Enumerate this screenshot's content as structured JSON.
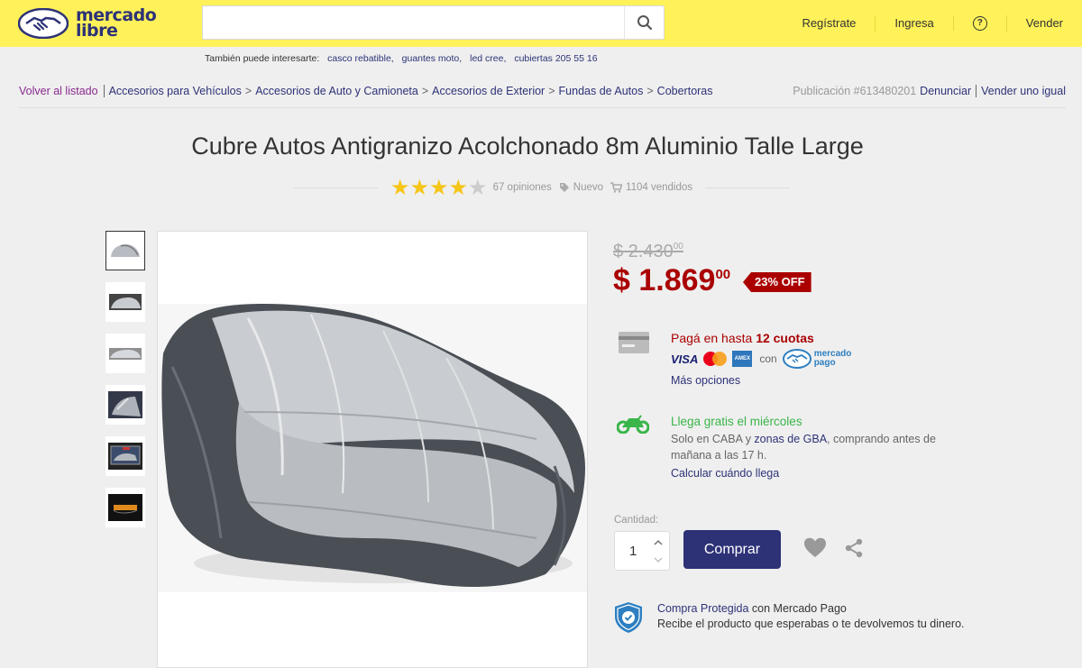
{
  "header": {
    "logo_line1": "mercado",
    "logo_line2": "libre",
    "search": {
      "value": "",
      "placeholder": ""
    },
    "nav": {
      "register": "Regístrate",
      "login": "Ingresa",
      "help": "?",
      "sell": "Vender"
    },
    "colors": {
      "bar": "#fff159",
      "brand": "#2d3277"
    }
  },
  "suggestions": {
    "label": "También puede interesarte:",
    "items": [
      "casco rebatible,",
      "guantes moto,",
      "led cree,",
      "cubiertas 205 55 16"
    ]
  },
  "breadcrumb": {
    "back": "Volver al listado",
    "path": [
      "Accesorios para Vehículos",
      "Accesorios de Auto y Camioneta",
      "Accesorios de Exterior",
      "Fundas de Autos",
      "Cobertoras"
    ],
    "separator": ">",
    "publication": "Publicación #613480201",
    "report": "Denunciar",
    "sell_same": "Vender uno igual"
  },
  "product": {
    "title": "Cubre Autos Antigranizo Acolchonado 8m Aluminio Talle Large",
    "rating": 4,
    "rating_max": 5,
    "reviews": "67 opiniones",
    "condition": "Nuevo",
    "sold": "1104 vendidos"
  },
  "gallery": {
    "thumbs": [
      "car-cover-front",
      "car-cover-side",
      "car-cover-profile",
      "car-cover-detail",
      "car-cover-package",
      "car-cover-label"
    ],
    "active_index": 0
  },
  "pricing": {
    "old_price": "$ 2.430",
    "old_cents": "00",
    "price": "$ 1.869",
    "cents": "00",
    "discount": "23% OFF"
  },
  "payment": {
    "head_prefix": "Pagá en hasta ",
    "head_bold": "12 cuotas",
    "visa": "VISA",
    "amex": "AMERICAN EXPRESS",
    "con": "con",
    "mp_line1": "mercado",
    "mp_line2": "pago",
    "more": "Más opciones"
  },
  "shipping": {
    "head": "Llega gratis el miércoles",
    "text_prefix": "Solo en CABA y ",
    "text_link": "zonas de GBA",
    "text_suffix": ", comprando antes de mañana a las 17 h.",
    "calc": "Calcular cuándo llega"
  },
  "purchase": {
    "qty_label": "Cantidad:",
    "qty_value": "1",
    "buy": "Comprar"
  },
  "protection": {
    "link": "Compra Protegida",
    "line1_suffix": " con Mercado Pago",
    "line2": "Recibe el producto que esperabas o te devolvemos tu dinero."
  }
}
